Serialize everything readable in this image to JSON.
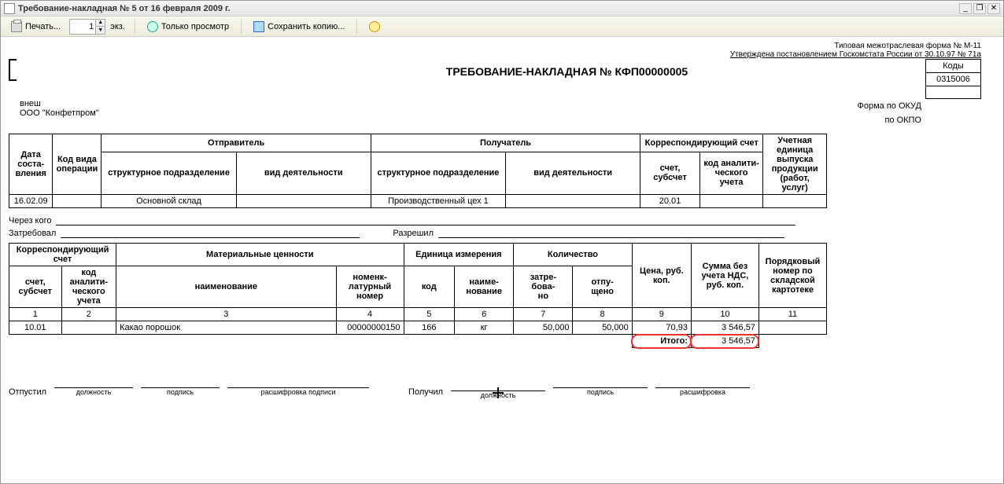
{
  "window": {
    "title": "Требование-накладная № 5 от 16 февраля 2009 г.",
    "minimize": "_",
    "maximize": "❐",
    "close": "✕"
  },
  "toolbar": {
    "print_label": "Печать...",
    "copies_value": "1",
    "copies_suffix": "экз.",
    "view_only_label": "Только просмотр",
    "save_copy_label": "Сохранить копию...",
    "help_label": ""
  },
  "header": {
    "form_type_line": "Типовая межотраслевая форма № М-11",
    "approved_line": "Утверждена постановлением Госкомстата России от 30.10.97 № 71а",
    "codes_header": "Коды",
    "doc_title": "ТРЕБОВАНИЕ-НАКЛАДНАЯ  №  КФП00000005",
    "label_form_okud": "Форма по ОКУД",
    "value_okud": "0315006",
    "label_okpo": "по ОКПО",
    "value_okpo": "",
    "org_ext": "внеш",
    "org_name": "ООО \"Конфетпром\""
  },
  "table1": {
    "h_date": "Дата соста-\nвления",
    "h_opcode": "Код вида операции",
    "h_sender": "Отправитель",
    "h_receiver": "Получатель",
    "h_corr": "Корреспондирующий счет",
    "h_unit": "Учетная единица выпуска продукции (работ, услуг)",
    "h_struct": "структурное подразделение",
    "h_activity": "вид деятельности",
    "h_acct": "счет, субсчет",
    "h_anal": "код аналити-\nческого учета",
    "row": {
      "date": "16.02.09",
      "opcode": "",
      "sender_struct": "Основной склад",
      "sender_act": "",
      "receiver_struct": "Производственный цех 1",
      "receiver_act": "",
      "acct": "20.01",
      "anal": "",
      "unit": ""
    }
  },
  "middle": {
    "through_label": "Через кого",
    "requested_label": "Затребовал",
    "allowed_label": "Разрешил"
  },
  "items_header": {
    "corr": "Корреспондирующий счет",
    "material": "Материальные ценности",
    "unit": "Единица измерения",
    "qty": "Количество",
    "price": "Цена, руб. коп.",
    "sum": "Сумма без учета НДС, руб. коп.",
    "ord": "Порядковый номер по складской картотеке",
    "acct": "счет, субсчет",
    "anal": "код аналити-\nческого учета",
    "name": "наименование",
    "nomen": "номенк-\nлатурный номер",
    "code": "код",
    "unitname": "наиме-\nнование",
    "req": "затре-\nбова-\nно",
    "rel": "отпу-\nщено",
    "cols": [
      "1",
      "2",
      "3",
      "4",
      "5",
      "6",
      "7",
      "8",
      "9",
      "10",
      "11"
    ]
  },
  "items": [
    {
      "acct": "10.01",
      "anal": "",
      "name": "Какао порошок",
      "nomen": "00000000150",
      "code": "166",
      "unitname": "кг",
      "req": "50,000",
      "rel": "50,000",
      "price": "70,93",
      "sum": "3 546,57",
      "ord": ""
    }
  ],
  "totals": {
    "label": "Итого:",
    "sum": "3 546,57"
  },
  "footer": {
    "released_label": "Отпустил",
    "received_label": "Получил",
    "role_label": "должность",
    "sign_label": "подпись",
    "decipher_label": "расшифровка подписи",
    "decipher_short": "расшифровка"
  }
}
